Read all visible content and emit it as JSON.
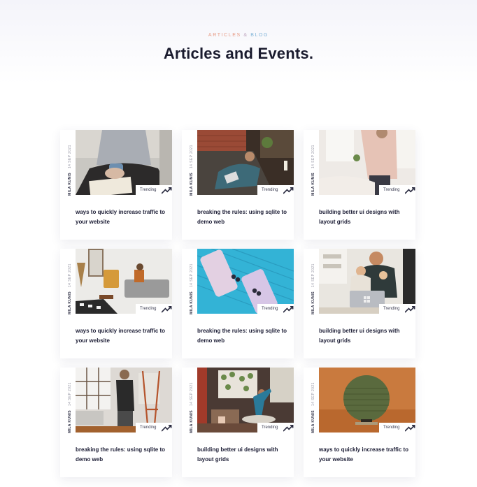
{
  "header": {
    "eyebrow_left": "ARTICLES",
    "eyebrow_amp": "&",
    "eyebrow_right": "BLOG",
    "title": "Articles and Events."
  },
  "cards": [
    {
      "author": "MILA KUNIS",
      "date": "14 SEP 2021",
      "badge": "Trending",
      "badge_icon": "trend-up-icon",
      "title": "ways to quickly increase traffic to your website",
      "image": "person-holding-mug"
    },
    {
      "author": "MILA KUNIS",
      "date": "14 SEP 2021",
      "badge": "Trending",
      "badge_icon": "trend-up-icon",
      "title": "breaking the rules: using sqlite to demo web",
      "image": "person-on-couch-with-tablet"
    },
    {
      "author": "MILA KUNIS",
      "date": "14 SEP 2021",
      "badge": "Trending",
      "badge_icon": "trend-up-icon",
      "title": "building better ui designs with layout grids",
      "image": "woman-in-bright-room"
    },
    {
      "author": "MILA KUNIS",
      "date": "14 SEP 2021",
      "badge": "Trending",
      "badge_icon": "trend-up-icon",
      "title": "ways to quickly increase traffic to your website",
      "image": "living-room-on-sofa"
    },
    {
      "author": "MILA KUNIS",
      "date": "14 SEP 2021",
      "badge": "Trending",
      "badge_icon": "trend-up-icon",
      "title": "breaking the rules: using sqlite to demo web",
      "image": "two-phones-on-blue"
    },
    {
      "author": "MILA KUNIS",
      "date": "14 SEP 2021",
      "badge": "Trending",
      "badge_icon": "trend-up-icon",
      "title": "building better ui designs with layout grids",
      "image": "family-with-laptop"
    },
    {
      "author": "MILA KUNIS",
      "date": "14 SEP 2021",
      "badge": "Trending",
      "badge_icon": "trend-up-icon",
      "title": "breaking the rules: using sqlite to demo web",
      "image": "man-painting-easel"
    },
    {
      "author": "MILA KUNIS",
      "date": "14 SEP 2021",
      "badge": "Trending",
      "badge_icon": "trend-up-icon",
      "title": "building better ui designs with layout grids",
      "image": "yoga-in-studio"
    },
    {
      "author": "MILA KUNIS",
      "date": "14 SEP 2021",
      "badge": "Trending",
      "badge_icon": "trend-up-icon",
      "title": "ways to quickly increase traffic to your website",
      "image": "round-speaker-on-orange"
    }
  ],
  "colors": {
    "eyebrow_left": "#e79a84",
    "eyebrow_right": "#7fb4d8",
    "title": "#1a1b2e",
    "card_bg": "#ffffff"
  }
}
